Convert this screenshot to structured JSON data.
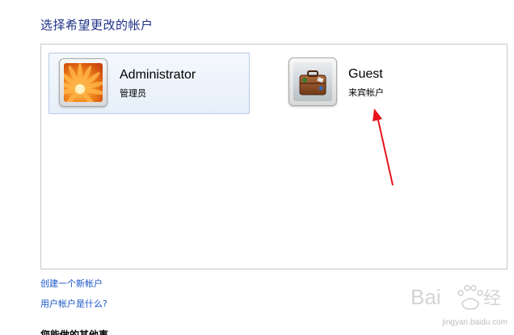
{
  "heading": "选择希望更改的帐户",
  "accounts": [
    {
      "name": "Administrator",
      "type": "管理员",
      "avatar_icon": "flower-avatar-icon",
      "selected": true
    },
    {
      "name": "Guest",
      "type": "来宾帐户",
      "avatar_icon": "briefcase-avatar-icon",
      "selected": false
    }
  ],
  "links": {
    "create_account": "创建一个新帐户",
    "what_is_account": "用户帐户是什么?"
  },
  "section_heading_partial": "您能做的其他事",
  "watermark": {
    "text": "jingyan.baidu.com"
  },
  "colors": {
    "heading": "#1e3287",
    "link": "#1a56c8",
    "annotation_arrow": "#e8141c"
  }
}
